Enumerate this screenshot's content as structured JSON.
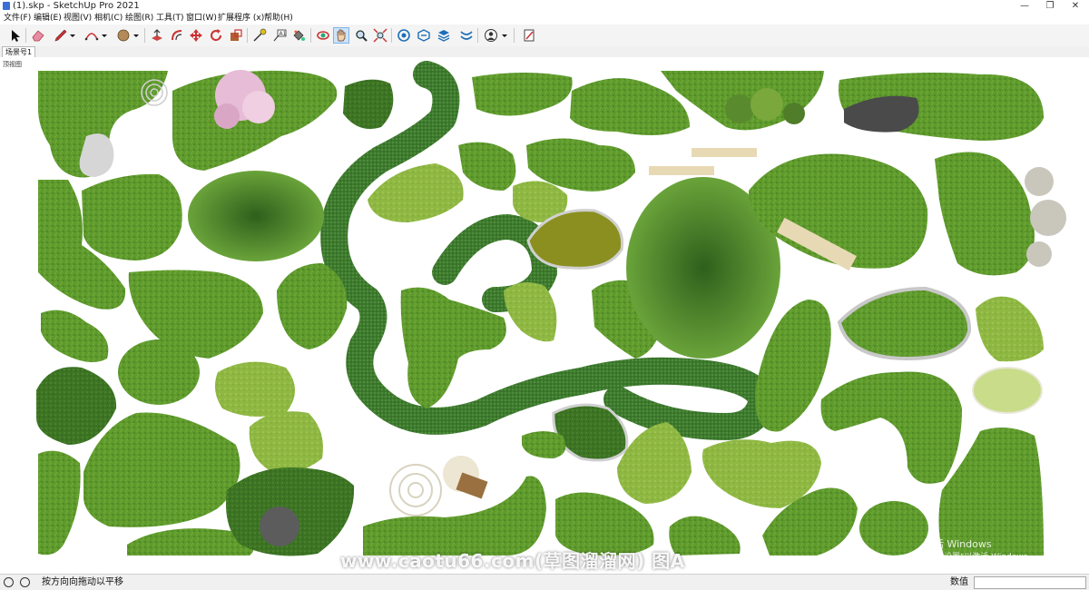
{
  "window": {
    "title": "(1).skp - SketchUp Pro 2021",
    "minimize_glyph": "—",
    "maximize_glyph": "❐",
    "close_glyph": "✕"
  },
  "menu": [
    "文件(F)",
    "编辑(E)",
    "视图(V)",
    "相机(C)",
    "绘图(R)",
    "工具(T)",
    "窗口(W)",
    "扩展程序 (x)",
    "帮助(H)"
  ],
  "toolbar": {
    "icons": [
      "select-icon",
      "eraser-icon",
      "pencil-icon",
      "dropdown-icon",
      "arc-icon",
      "dropdown-icon",
      "shape-icon",
      "dropdown-icon",
      "push-pull-icon",
      "offset-icon",
      "move-icon",
      "rotate-icon",
      "scale-icon",
      "tape-measure-icon",
      "text-icon",
      "paint-bucket-icon",
      "orbit-icon",
      "pan-icon",
      "zoom-icon",
      "zoom-extents-icon",
      "warehouse-icon",
      "extension-warehouse-icon",
      "layout-icon",
      "styles-icon",
      "user-icon",
      "dropdown-icon",
      "send-layout-icon"
    ],
    "active_icon": "pan-icon"
  },
  "scene_tab": "场景号1",
  "viewport": {
    "label": "顶视图",
    "background": "#ffffff",
    "lawn_colors": [
      "#5f9a2c",
      "#4c8a2a",
      "#78a838",
      "#90b840",
      "#3f7a24",
      "#6aa43a",
      "#a9c85a"
    ],
    "watermark": "www.caotu66.com(草图溜溜网) 图A",
    "activation_title": "激活 Windows",
    "activation_text": "转到\"设置\"以激活 Windows。"
  },
  "status": {
    "hint": "按方向向拖动以平移",
    "measurements_label": "数值",
    "measurements_value": ""
  }
}
